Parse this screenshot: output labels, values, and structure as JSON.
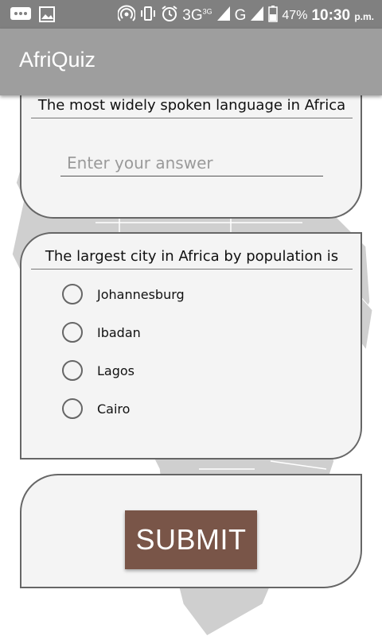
{
  "status_bar": {
    "network_3g": "3G",
    "network_3g_super": "3G",
    "network_g": "G",
    "battery": "47%",
    "time": "10:30",
    "time_suffix": "p.m."
  },
  "app_bar": {
    "title": "AfriQuiz"
  },
  "question1": {
    "text": "The most widely spoken language in Africa",
    "placeholder": "Enter your answer"
  },
  "question2": {
    "text": "The largest city in Africa by population is",
    "options": [
      "Johannesburg",
      "Ibadan",
      "Lagos",
      "Cairo"
    ]
  },
  "submit_label": "SUBMIT",
  "colors": {
    "status_bar": "#808080",
    "app_bar": "#9e9e9e",
    "submit_button": "#795548",
    "card_background": "#f4f4f4",
    "map_fill": "#cfcfcf"
  }
}
